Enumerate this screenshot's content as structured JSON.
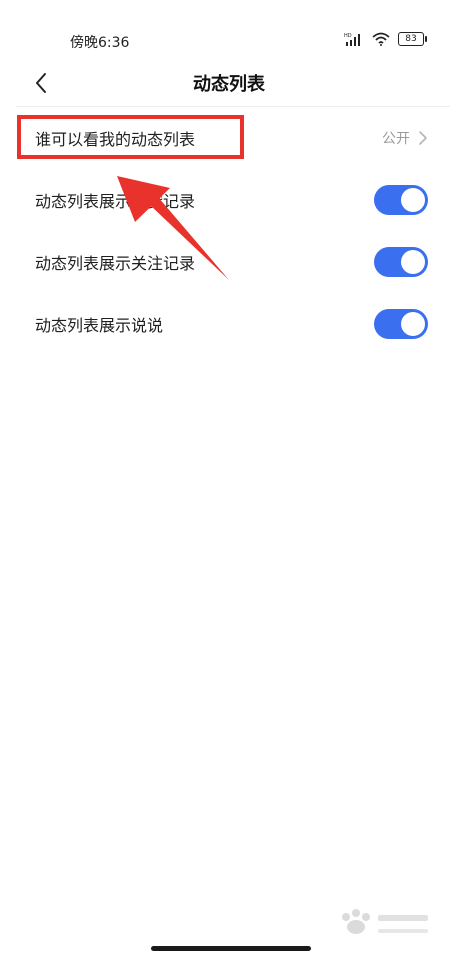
{
  "status_bar": {
    "time": "傍晚6:36",
    "network_label": "HD",
    "battery_level": "83"
  },
  "nav": {
    "title": "动态列表"
  },
  "settings": {
    "who_can_see": {
      "label": "谁可以看我的动态列表",
      "value": "公开"
    },
    "toggles": [
      {
        "label": "动态列表展示点赞记录",
        "on": true
      },
      {
        "label": "动态列表展示关注记录",
        "on": true
      },
      {
        "label": "动态列表展示说说",
        "on": true
      }
    ]
  },
  "colors": {
    "toggle_on": "#3a6ff0",
    "annotation_red": "#e8322b"
  },
  "icons": {
    "back": "chevron-left-icon",
    "arrow": "chevron-right-icon",
    "signal": "signal-icon",
    "wifi": "wifi-icon",
    "battery": "battery-icon"
  }
}
